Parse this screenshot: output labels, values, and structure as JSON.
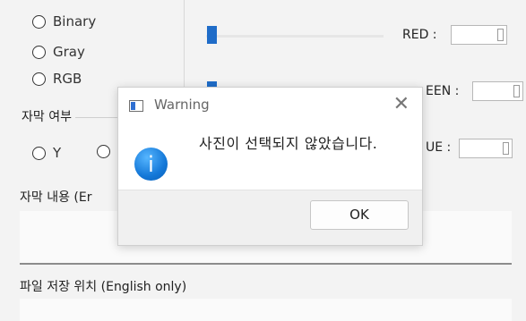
{
  "filter_options": [
    "Binary",
    "Gray",
    "RGB"
  ],
  "subtitle_group": {
    "title": "자막 여부",
    "options": [
      "Y"
    ]
  },
  "color_controls": {
    "red_label": "RED :",
    "green_label": "EEN :",
    "blue_label": "UE :"
  },
  "subtitle_content_label": "자막 내용 (Er",
  "save_location_label": "파일 저장 위치 (English only)",
  "dialog": {
    "title": "Warning",
    "close_glyph": "✕",
    "message": "사진이 선택되지 않았습니다.",
    "info_glyph": "i",
    "ok_label": "OK"
  },
  "colors": {
    "accent": "#1f6cc8",
    "info_icon": "#1478d8"
  }
}
